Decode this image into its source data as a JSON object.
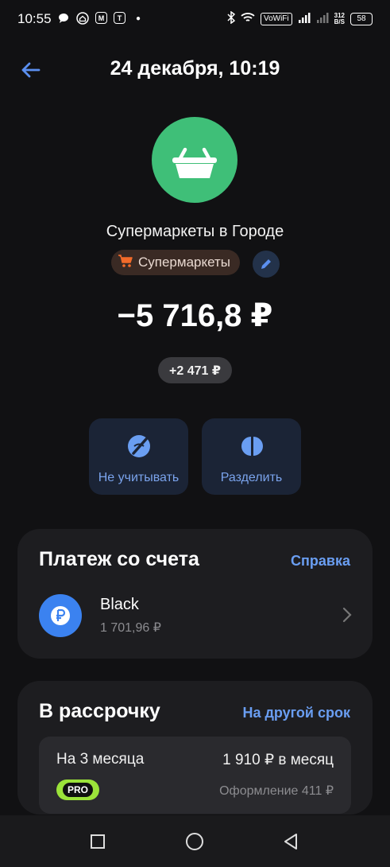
{
  "status_bar": {
    "time": "10:55",
    "left_icons": [
      "chat-icon",
      "home-icon",
      "m-app-icon",
      "t-app-icon",
      "dot"
    ],
    "vowifi": "VoWiFi",
    "speed_top": "312",
    "speed_bottom": "B/S",
    "battery": "58"
  },
  "header": {
    "title": "24 декабря, 10:19"
  },
  "merchant": {
    "name": "Супермаркеты в Городе",
    "category": "Супермаркеты",
    "logo_color": "#3fbf78",
    "amount": "−5 716,8 ₽",
    "cashback": "+2 471 ₽"
  },
  "actions": [
    {
      "label": "Не учитывать",
      "icon": "eye-off-icon"
    },
    {
      "label": "Разделить",
      "icon": "split-icon"
    }
  ],
  "payment": {
    "title": "Платеж со счета",
    "help": "Справка",
    "account_name": "Black",
    "account_balance": "1 701,96 ₽"
  },
  "installment": {
    "title": "В рассрочку",
    "other_term": "На другой срок",
    "plan": "На 3 месяца",
    "monthly": "1 910 ₽ в месяц",
    "badge": "PRO",
    "fee": "Оформление 411 ₽"
  },
  "colors": {
    "accent": "#6a9ef2",
    "background": "#111113",
    "card": "#1d1d20",
    "pro": "#9be33a"
  }
}
